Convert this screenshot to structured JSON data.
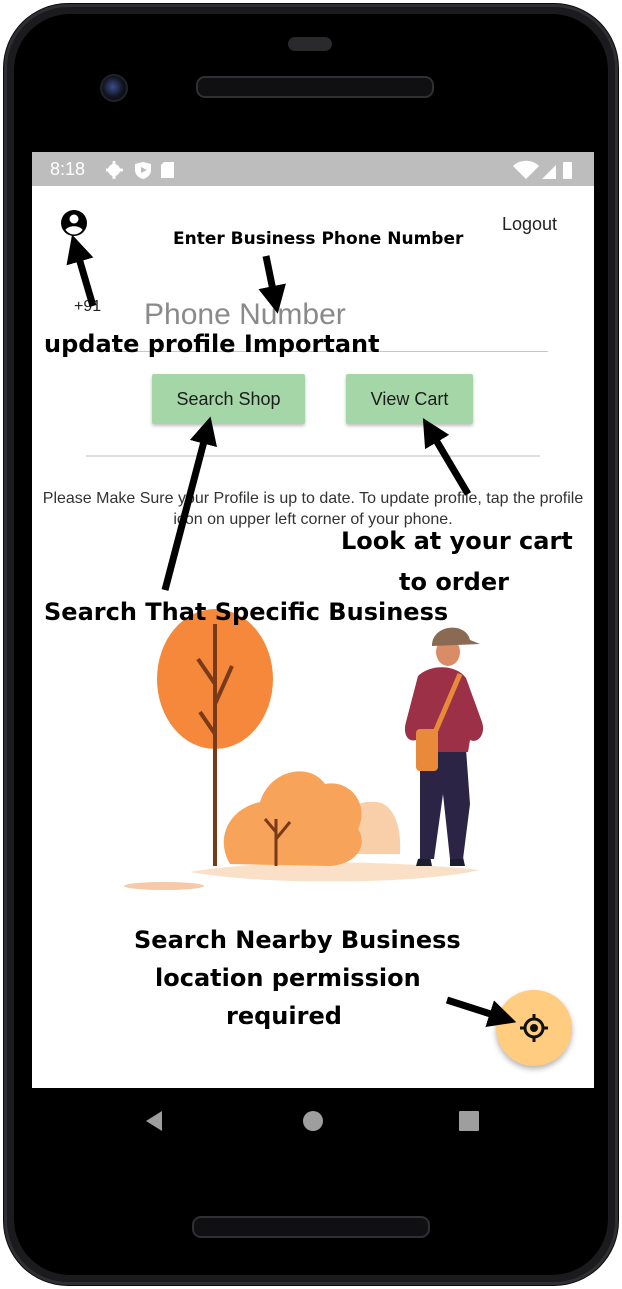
{
  "status_bar": {
    "time": "8:18",
    "icons": [
      "gear-icon",
      "shield-icon",
      "sd-card-icon",
      "wifi-icon",
      "signal-icon",
      "battery-icon"
    ]
  },
  "app": {
    "logout_label": "Logout",
    "country_code": "+91",
    "phone_placeholder": "Phone Number",
    "search_button_label": "Search Shop",
    "cart_button_label": "View Cart",
    "info_message": "Please Make Sure your Profile is up to date. To update profile, tap the profile icon on upper left corner of your phone.",
    "accent_color": "#a5d6a7",
    "fab_color": "#ffcc80"
  },
  "annotations": {
    "enter_phone": "Enter Business Phone Number",
    "update_profile": "update profile Important",
    "look_cart_line1": "Look at your cart",
    "look_cart_line2": "to order",
    "search_business": "Search That Specific Business",
    "nearby_line1": "Search Nearby Business",
    "nearby_line2": "location permission",
    "nearby_line3": "required"
  },
  "nav_bar": {
    "icons": [
      "back-icon",
      "home-icon",
      "recents-icon"
    ]
  }
}
